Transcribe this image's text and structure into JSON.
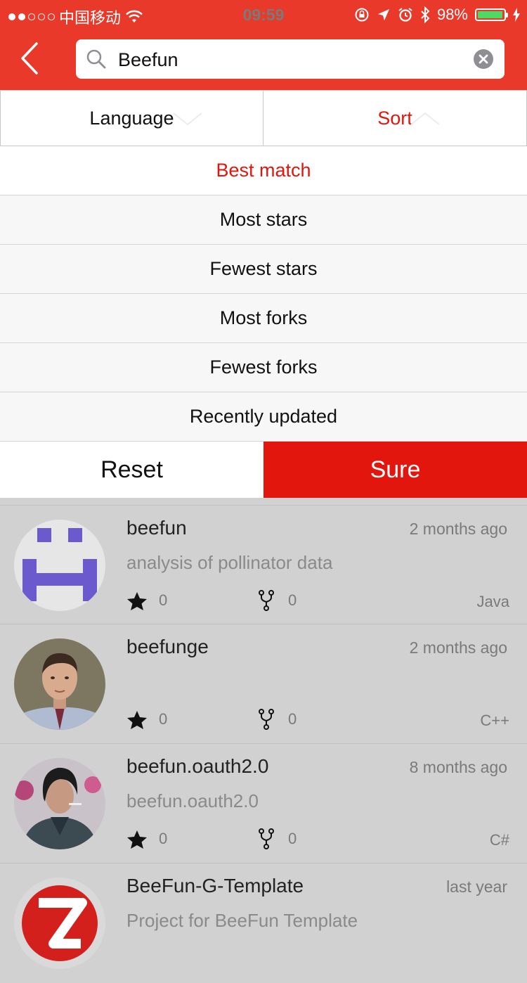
{
  "status_bar": {
    "carrier": "中国移动",
    "time": "09:59",
    "battery": "98%"
  },
  "search": {
    "value": "Beefun",
    "placeholder": ""
  },
  "filters": {
    "language_label": "Language",
    "sort_label": "Sort"
  },
  "sort_options": [
    {
      "label": "Best match",
      "selected": true
    },
    {
      "label": "Most stars",
      "selected": false
    },
    {
      "label": "Fewest stars",
      "selected": false
    },
    {
      "label": "Most forks",
      "selected": false
    },
    {
      "label": "Fewest forks",
      "selected": false
    },
    {
      "label": "Recently updated",
      "selected": false
    }
  ],
  "actions": {
    "reset_label": "Reset",
    "sure_label": "Sure"
  },
  "repos": [
    {
      "name": "beefun",
      "updated": "2 months ago",
      "description": "analysis of pollinator data",
      "stars": "0",
      "forks": "0",
      "language": "Java"
    },
    {
      "name": "beefunge",
      "updated": "2 months ago",
      "description": "",
      "stars": "0",
      "forks": "0",
      "language": "C++"
    },
    {
      "name": "beefun.oauth2.0",
      "updated": "8 months ago",
      "description": "beefun.oauth2.0",
      "stars": "0",
      "forks": "0",
      "language": "C#"
    },
    {
      "name": "BeeFun-G-Template",
      "updated": "last year",
      "description": "Project for BeeFun Template",
      "stars": "",
      "forks": "",
      "language": ""
    }
  ],
  "colors": {
    "header": "#e8392b",
    "accent": "#e3160d",
    "battery": "#4cd964"
  }
}
